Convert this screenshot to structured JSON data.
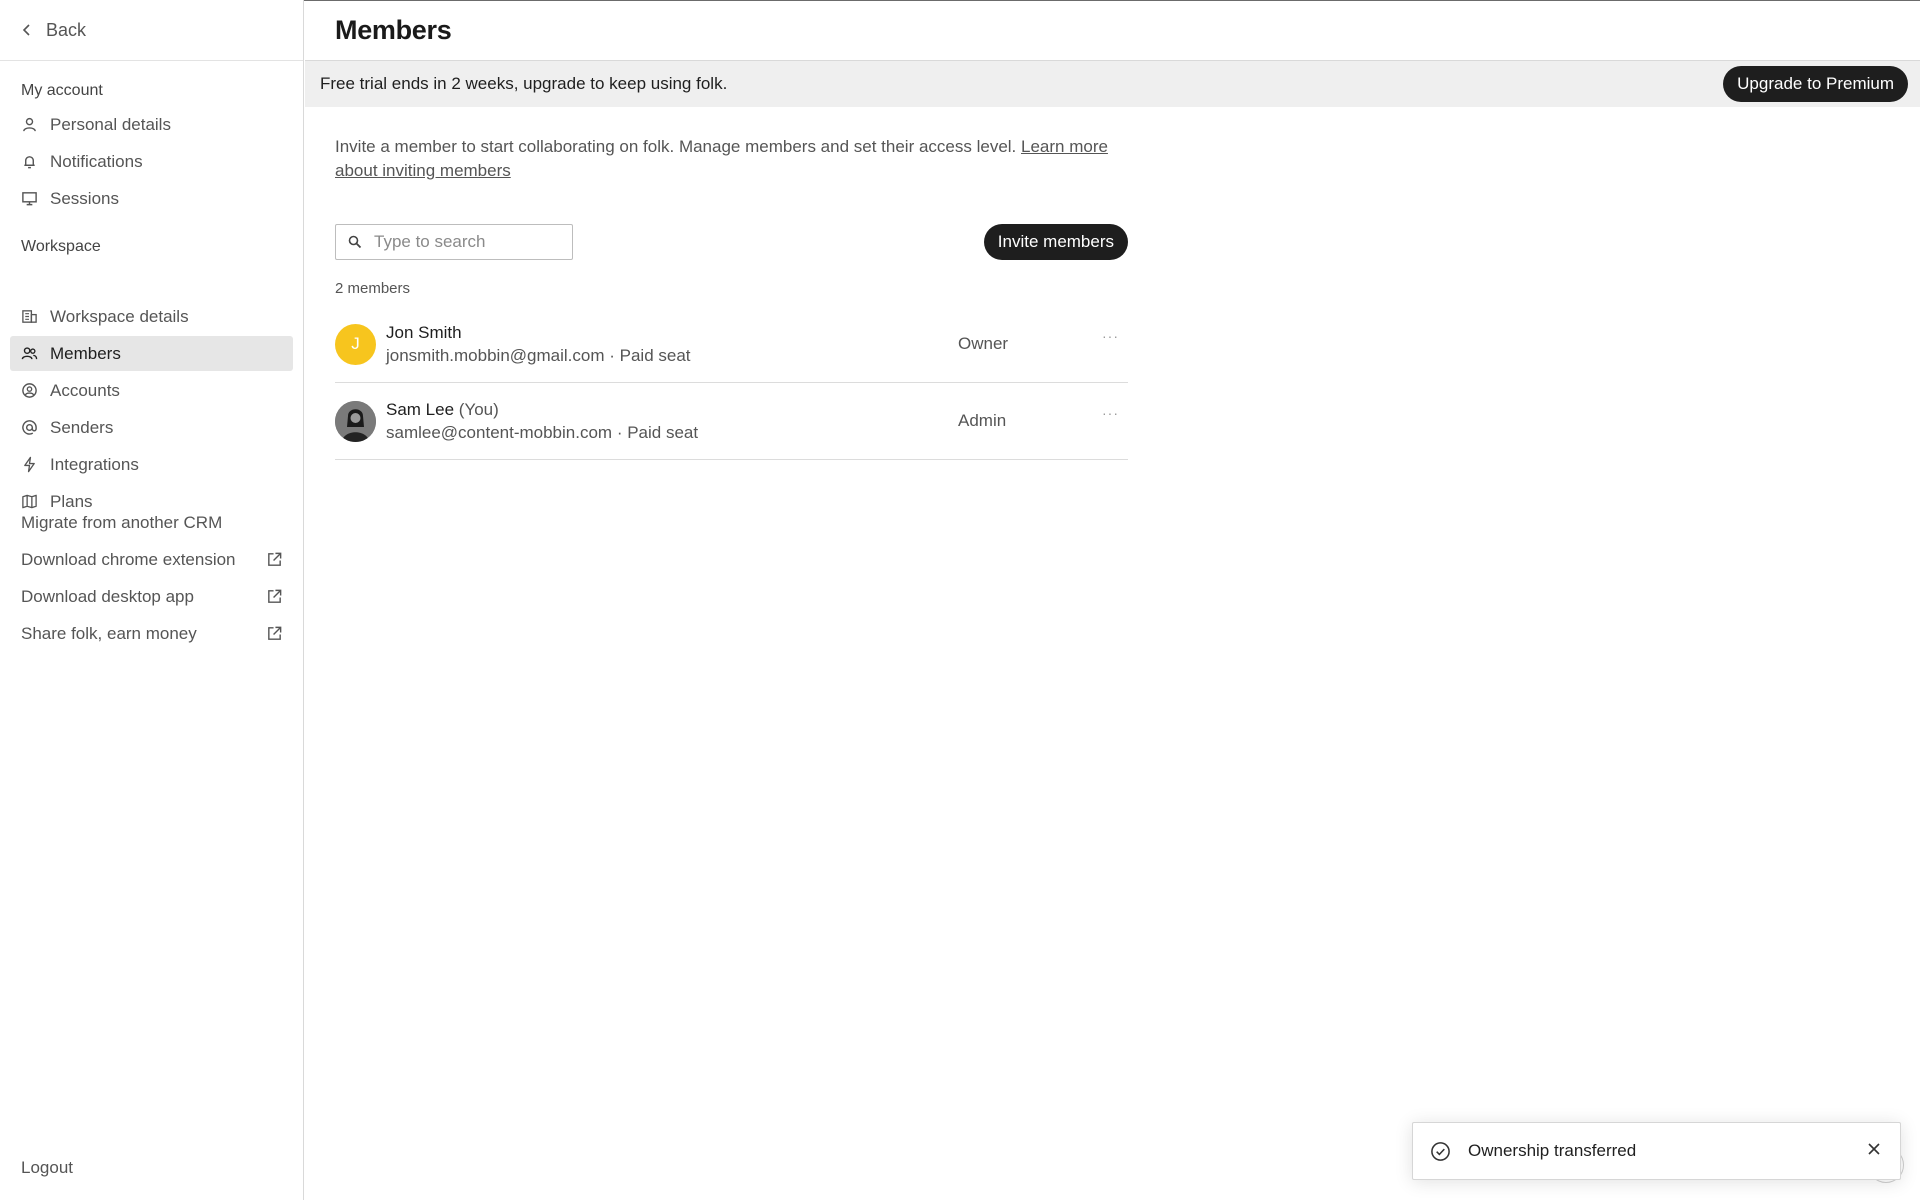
{
  "sidebar": {
    "back_label": "Back",
    "account_section": {
      "title": "My account",
      "items": [
        {
          "label": "Personal details",
          "icon": "user-icon"
        },
        {
          "label": "Notifications",
          "icon": "bell-icon"
        },
        {
          "label": "Sessions",
          "icon": "monitor-icon"
        }
      ]
    },
    "workspace_section": {
      "title": "Workspace",
      "items": [
        {
          "label": "Workspace details",
          "icon": "building-icon"
        },
        {
          "label": "Members",
          "icon": "users-icon",
          "active": true
        },
        {
          "label": "Accounts",
          "icon": "user-circle-icon"
        },
        {
          "label": "Senders",
          "icon": "at-sign-icon"
        },
        {
          "label": "Integrations",
          "icon": "bolt-icon"
        },
        {
          "label": "Plans",
          "icon": "map-icon"
        }
      ]
    },
    "links": [
      {
        "label": "Migrate from another CRM",
        "external": false
      },
      {
        "label": "Download chrome extension",
        "external": true
      },
      {
        "label": "Download desktop app",
        "external": true
      },
      {
        "label": "Share folk, earn money",
        "external": true
      }
    ],
    "logout_label": "Logout"
  },
  "header": {
    "title": "Members"
  },
  "banner": {
    "text": "Free trial ends in 2 weeks, upgrade to keep using folk.",
    "button_label": "Upgrade to Premium"
  },
  "main": {
    "intro_text": "Invite a member to start collaborating on folk. Manage members and set their access level. ",
    "intro_link": "Learn more about inviting members",
    "search_placeholder": "Type to search",
    "invite_button": "Invite members",
    "member_count": "2 members",
    "members": [
      {
        "name": "Jon Smith",
        "you": "",
        "email": "jonsmith.mobbin@gmail.com",
        "seat": "Paid seat",
        "role": "Owner",
        "initial": "J",
        "more": "···"
      },
      {
        "name": "Sam Lee",
        "you": "(You)",
        "email": "samlee@content-mobbin.com",
        "seat": "Paid seat",
        "role": "Admin",
        "initial": "",
        "more": "···"
      }
    ]
  },
  "toast": {
    "message": "Ownership transferred"
  },
  "colors": {
    "accent_dark": "#1e1e1e",
    "avatar_yellow": "#f7c51e",
    "active_bg": "#e6e6e6"
  }
}
